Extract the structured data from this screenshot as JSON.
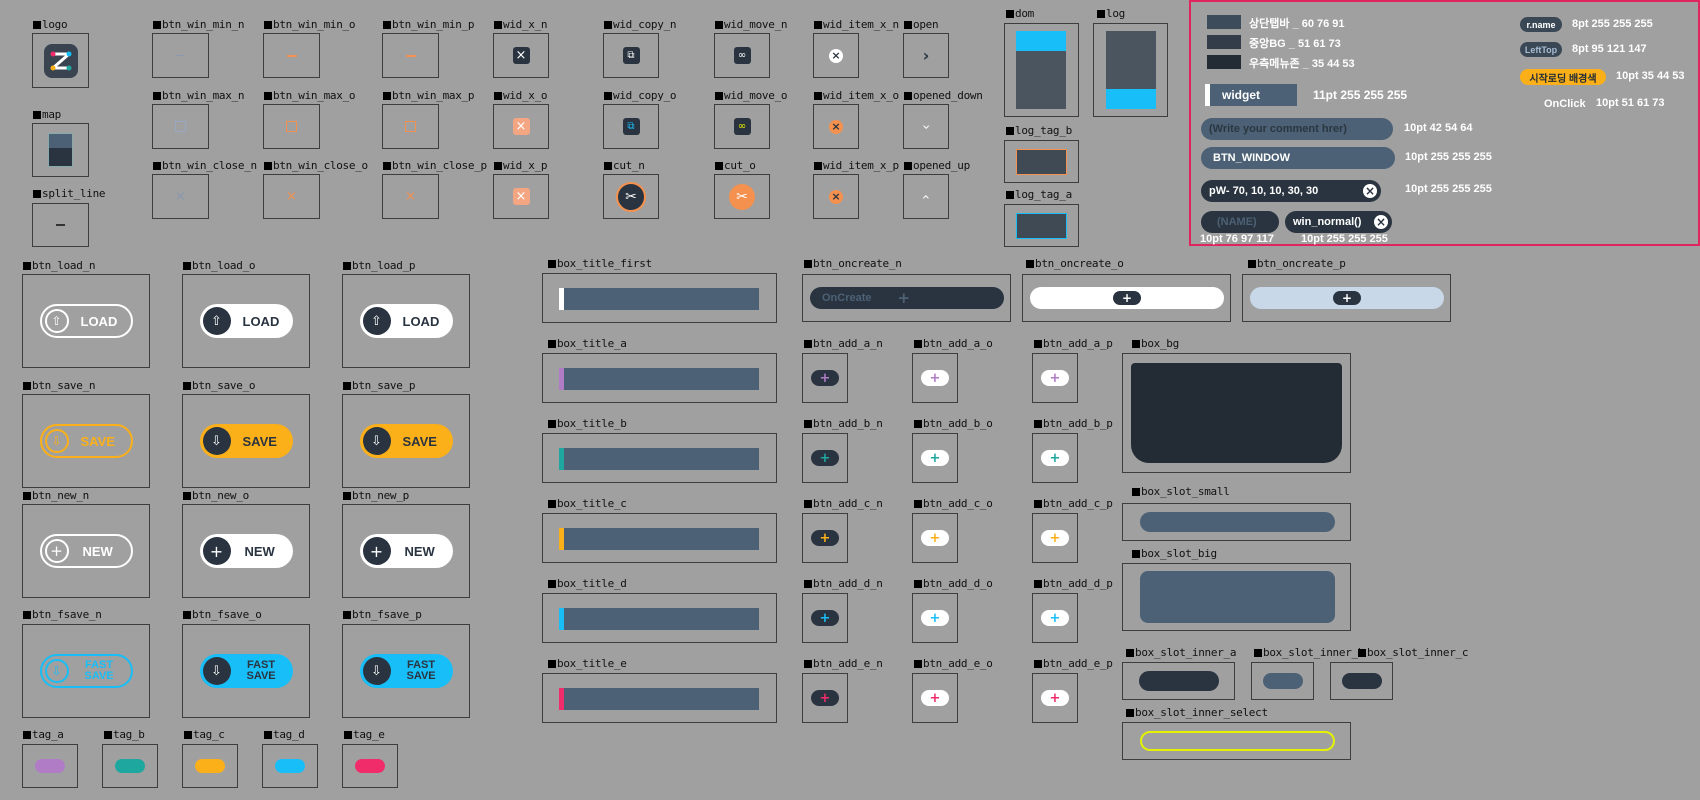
{
  "labels": {
    "logo": "logo",
    "map": "map",
    "split_line": "split_line",
    "btn_win_min_n": "btn_win_min_n",
    "btn_win_min_o": "btn_win_min_o",
    "btn_win_min_p": "btn_win_min_p",
    "btn_win_max_n": "btn_win_max_n",
    "btn_win_max_o": "btn_win_max_o",
    "btn_win_max_p": "btn_win_max_p",
    "btn_win_close_n": "btn_win_close_n",
    "btn_win_close_o": "btn_win_close_o",
    "btn_win_close_p": "btn_win_close_p",
    "wid_x_n": "wid_x_n",
    "wid_x_o": "wid_x_o",
    "wid_x_p": "wid_x_p",
    "wid_copy_n": "wid_copy_n",
    "wid_copy_o": "wid_copy_o",
    "cut_n": "cut_n",
    "wid_move_n": "wid_move_n",
    "wid_move_o": "wid_move_o",
    "cut_o": "cut_o",
    "wid_item_x_n": "wid_item_x_n",
    "wid_item_x_o": "wid_item_x_o",
    "wid_item_x_p": "wid_item_x_p",
    "open": "open",
    "opened_down": "opened_down",
    "opened_up": "opened_up",
    "dom": "dom",
    "log": "log",
    "log_tag_b": "log_tag_b",
    "log_tag_a": "log_tag_a",
    "btn_load_n": "btn_load_n",
    "btn_load_o": "btn_load_o",
    "btn_load_p": "btn_load_p",
    "btn_save_n": "btn_save_n",
    "btn_save_o": "btn_save_o",
    "btn_save_p": "btn_save_p",
    "btn_new_n": "btn_new_n",
    "btn_new_o": "btn_new_o",
    "btn_new_p": "btn_new_p",
    "btn_fsave_n": "btn_fsave_n",
    "btn_fsave_o": "btn_fsave_o",
    "btn_fsave_p": "btn_fsave_p",
    "tag_a": "tag_a",
    "tag_b": "tag_b",
    "tag_c": "tag_c",
    "tag_d": "tag_d",
    "tag_e": "tag_e",
    "box_title_first": "box_title_first",
    "box_title_a": "box_title_a",
    "box_title_b": "box_title_b",
    "box_title_c": "box_title_c",
    "box_title_d": "box_title_d",
    "box_title_e": "box_title_e",
    "btn_oncreate_n": "btn_oncreate_n",
    "btn_oncreate_o": "btn_oncreate_o",
    "btn_oncreate_p": "btn_oncreate_p",
    "btn_add_a_n": "btn_add_a_n",
    "btn_add_a_o": "btn_add_a_o",
    "btn_add_a_p": "btn_add_a_p",
    "btn_add_b_n": "btn_add_b_n",
    "btn_add_b_o": "btn_add_b_o",
    "btn_add_b_p": "btn_add_b_p",
    "btn_add_c_n": "btn_add_c_n",
    "btn_add_c_o": "btn_add_c_o",
    "btn_add_c_p": "btn_add_c_p",
    "btn_add_d_n": "btn_add_d_n",
    "btn_add_d_o": "btn_add_d_o",
    "btn_add_d_p": "btn_add_d_p",
    "btn_add_e_n": "btn_add_e_n",
    "btn_add_e_o": "btn_add_e_o",
    "btn_add_e_p": "btn_add_e_p",
    "box_bg": "box_bg",
    "box_slot_small": "box_slot_small",
    "box_slot_big": "box_slot_big",
    "box_slot_inner_a": "box_slot_inner_a",
    "box_slot_inner_b": "box_slot_inner_b",
    "box_slot_inner_c": "box_slot_inner_c",
    "box_slot_inner_select": "box_slot_inner_select"
  },
  "buttons": {
    "load": "LOAD",
    "save": "SAVE",
    "new": "NEW",
    "fast": "FAST",
    "fast_save": "SAVE",
    "oncreate": "OnCreate"
  },
  "panel": {
    "swatch_top": "상단탭바 _ 60 76 91",
    "swatch_mid": "중앙BG _ 51 61 73",
    "swatch_right": "우측메뉴존 _ 35 44 53",
    "widget": "widget",
    "widget_spec": "11pt 255 255 255",
    "comment_placeholder": "(Write your comment hrer)",
    "comment_spec": "10pt 42 54 64",
    "btn_window": "BTN_WINDOW",
    "btn_window_spec": "10pt 255 255 255",
    "pw": "pW- 70, 10, 10, 30, 30",
    "pw_spec": "10pt 255 255 255",
    "name_placeholder": "(NAME)",
    "win_normal": "win_normal()",
    "name_spec": "10pt 76 97 117",
    "win_normal_spec": "10pt 255 255 255",
    "rname": "r.name",
    "rname_spec": "8pt 255 255 255",
    "lefttop": "LeftTop",
    "lefttop_spec": "8pt 95 121 147",
    "loading": "시작로딩 배경색",
    "loading_spec": "10pt 35 44 53",
    "onclick": "OnClick",
    "onclick_spec": "10pt 51 61 73"
  },
  "colors": {
    "dark": "#2a3440",
    "slate": "#4c6175",
    "orange": "#f4a582",
    "yellow": "#fbb019",
    "blue": "#18bef7",
    "purple": "#b07cc6",
    "teal": "#1ea79f",
    "pink": "#f02c6b",
    "lime": "#e4f200"
  }
}
